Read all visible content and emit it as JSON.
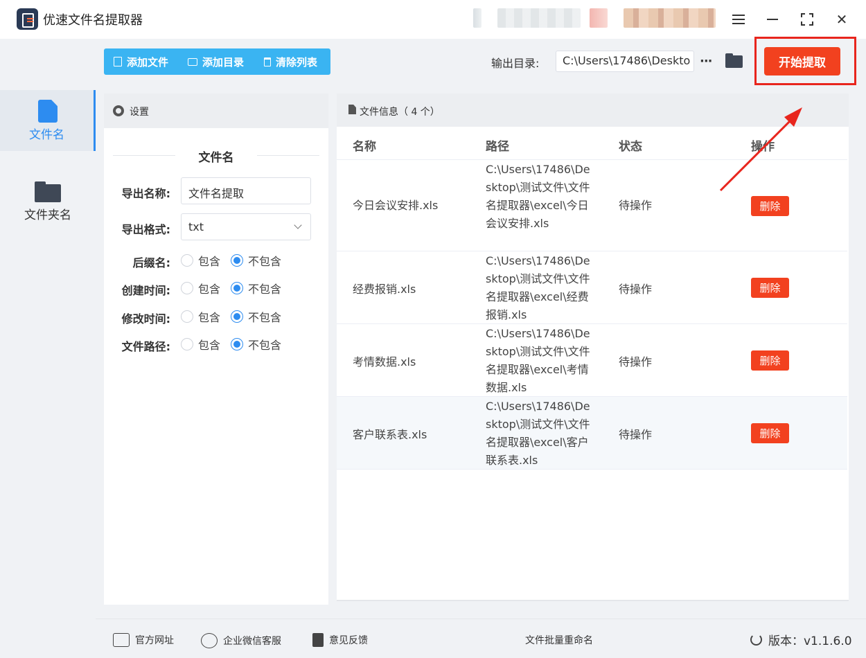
{
  "window": {
    "title": "优速文件名提取器"
  },
  "nav": {
    "items": [
      {
        "label": "文件名",
        "active": true,
        "icon": "document-icon"
      },
      {
        "label": "文件夹名",
        "active": false,
        "icon": "folder-icon"
      }
    ]
  },
  "toolbar": {
    "add_file": "添加文件",
    "add_dir": "添加目录",
    "clear_list": "清除列表",
    "output_label": "输出目录:",
    "output_path": "C:\\Users\\17486\\Deskto",
    "more": "···",
    "start": "开始提取"
  },
  "settings": {
    "header": "设置",
    "section_title": "文件名",
    "export_name_label": "导出名称:",
    "export_name_value": "文件名提取",
    "export_format_label": "导出格式:",
    "export_format_value": "txt",
    "options": [
      {
        "label": "后缀名:",
        "include": "包含",
        "exclude": "不包含",
        "selected": "exclude"
      },
      {
        "label": "创建时间:",
        "include": "包含",
        "exclude": "不包含",
        "selected": "exclude"
      },
      {
        "label": "修改时间:",
        "include": "包含",
        "exclude": "不包含",
        "selected": "exclude"
      },
      {
        "label": "文件路径:",
        "include": "包含",
        "exclude": "不包含",
        "selected": "exclude"
      }
    ]
  },
  "files": {
    "header": "文件信息（ 4 个）",
    "columns": [
      "名称",
      "路径",
      "状态",
      "操作"
    ],
    "rows": [
      {
        "name": "今日会议安排.xls",
        "path": "C:\\Users\\17486\\Desktop\\测试文件\\文件名提取器\\excel\\今日会议安排.xls",
        "status": "待操作",
        "action": "删除"
      },
      {
        "name": "经费报销.xls",
        "path": "C:\\Users\\17486\\Desktop\\测试文件\\文件名提取器\\excel\\经费报销.xls",
        "status": "待操作",
        "action": "删除"
      },
      {
        "name": "考情数据.xls",
        "path": "C:\\Users\\17486\\Desktop\\测试文件\\文件名提取器\\excel\\考情数据.xls",
        "status": "待操作",
        "action": "删除"
      },
      {
        "name": "客户联系表.xls",
        "path": "C:\\Users\\17486\\Desktop\\测试文件\\文件名提取器\\excel\\客户联系表.xls",
        "status": "待操作",
        "action": "删除"
      }
    ]
  },
  "footer": {
    "website": "官方网址",
    "wechat": "企业微信客服",
    "feedback": "意见反馈",
    "promo": "文件批量重命名",
    "version": "版本：v1.1.6.0"
  },
  "colors": {
    "accent": "#2d8cf0",
    "toolbar": "#3ab4f2",
    "danger": "#f2411f",
    "highlight": "#e8251d"
  }
}
